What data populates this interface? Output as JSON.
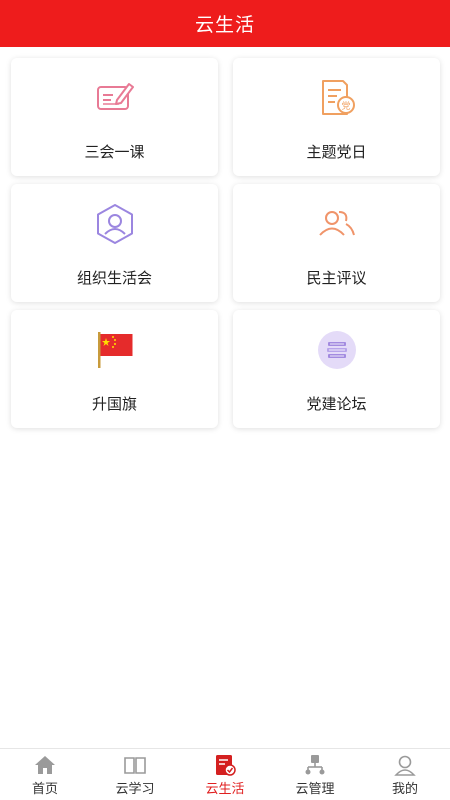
{
  "header": {
    "title": "云生活"
  },
  "cards": [
    {
      "label": "三会一课",
      "icon": "pen-certificate-icon"
    },
    {
      "label": "主题党日",
      "icon": "party-document-icon"
    },
    {
      "label": "组织生活会",
      "icon": "hexagon-person-icon"
    },
    {
      "label": "民主评议",
      "icon": "users-icon"
    },
    {
      "label": "升国旗",
      "icon": "china-flag-icon"
    },
    {
      "label": "党建论坛",
      "icon": "book-stack-icon"
    }
  ],
  "tabbar": {
    "items": [
      {
        "label": "首页",
        "icon": "home-icon"
      },
      {
        "label": "云学习",
        "icon": "open-book-icon"
      },
      {
        "label": "云生活",
        "icon": "cloud-life-icon",
        "active": true
      },
      {
        "label": "云管理",
        "icon": "org-chart-icon"
      },
      {
        "label": "我的",
        "icon": "profile-icon"
      }
    ]
  },
  "colors": {
    "primary": "#ee1c1c",
    "active_tab": "#e02020"
  }
}
